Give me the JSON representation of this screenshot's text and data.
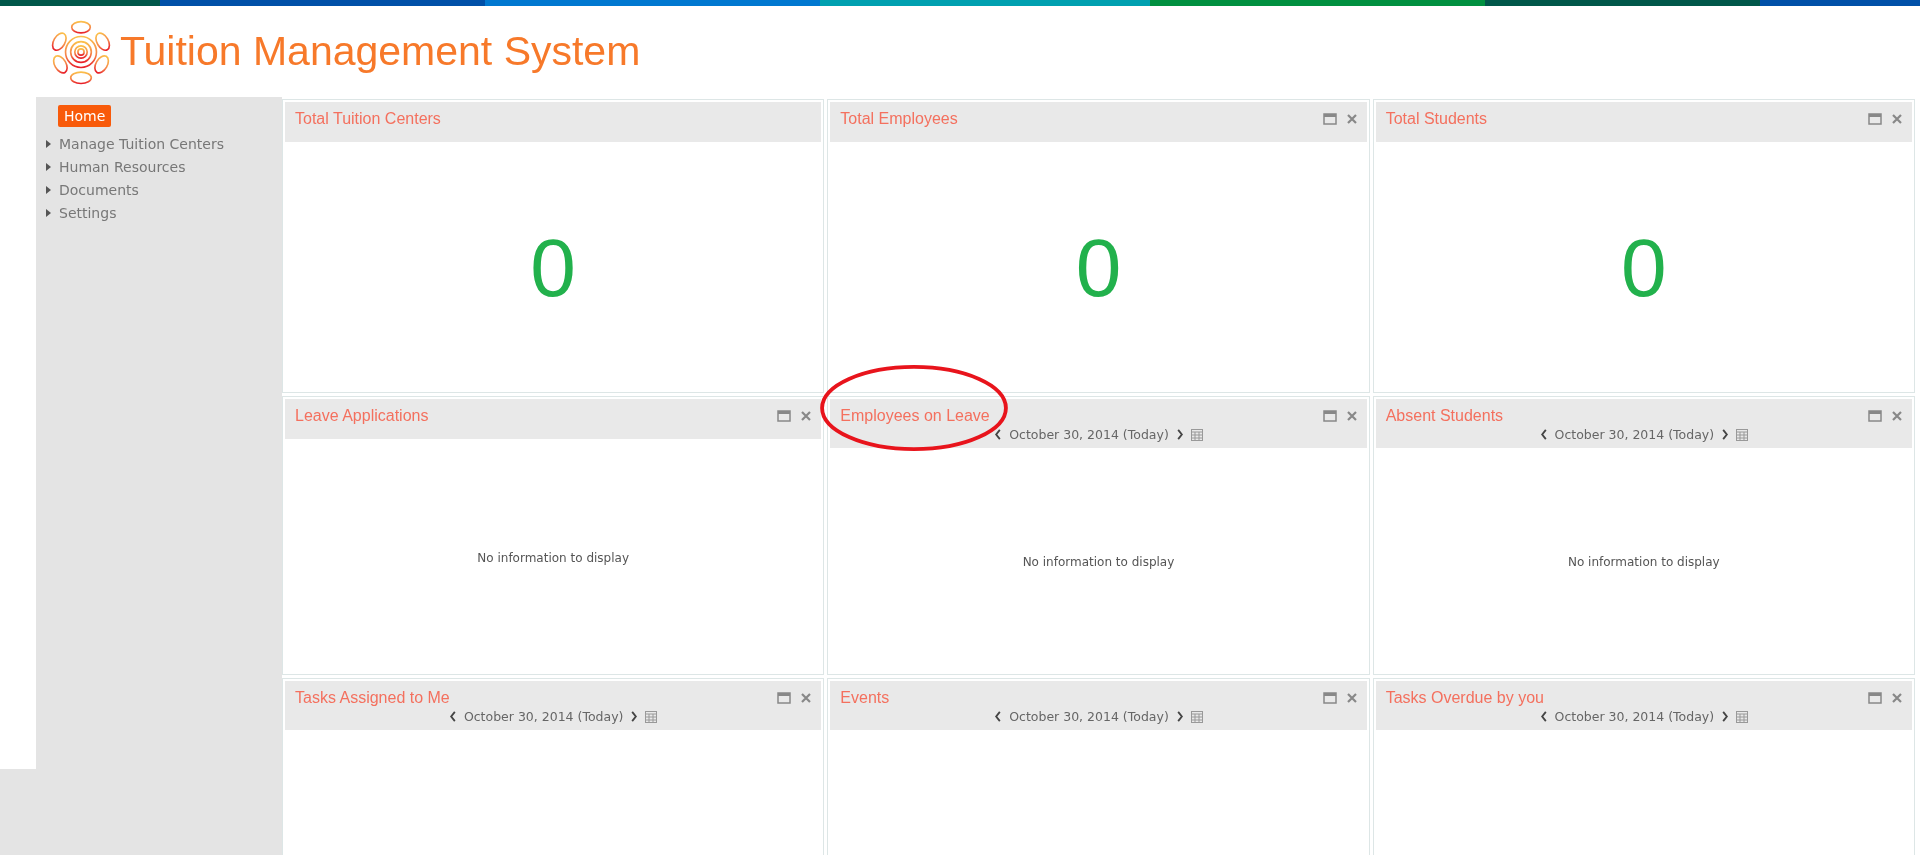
{
  "header": {
    "title": "Tuition Management System"
  },
  "sidebar": {
    "items": [
      {
        "label": "Home",
        "selected": true,
        "kind": "link"
      },
      {
        "label": "Manage Tuition Centers",
        "selected": false,
        "kind": "group"
      },
      {
        "label": "Human Resources",
        "selected": false,
        "kind": "group"
      },
      {
        "label": "Documents",
        "selected": false,
        "kind": "group"
      },
      {
        "label": "Settings",
        "selected": false,
        "kind": "group"
      }
    ]
  },
  "widgets": [
    {
      "title": "Total Tuition Centers",
      "kind": "count",
      "value": "0",
      "controls": false,
      "highlighted": false
    },
    {
      "title": "Total Employees",
      "kind": "count",
      "value": "0",
      "controls": true,
      "highlighted": false
    },
    {
      "title": "Total Students",
      "kind": "count",
      "value": "0",
      "controls": true,
      "highlighted": false
    },
    {
      "title": "Leave Applications",
      "kind": "message",
      "message": "No information to display",
      "controls": true,
      "highlighted": false
    },
    {
      "title": "Employees on Leave",
      "kind": "message",
      "date": "October 30, 2014 (Today)",
      "message": "No information to display",
      "controls": true,
      "highlighted": true
    },
    {
      "title": "Absent Students",
      "kind": "message",
      "date": "October 30, 2014 (Today)",
      "message": "No information to display",
      "controls": true,
      "highlighted": false
    },
    {
      "title": "Tasks Assigned to Me",
      "kind": "empty",
      "date": "October 30, 2014 (Today)",
      "controls": true,
      "highlighted": false
    },
    {
      "title": "Events",
      "kind": "empty",
      "date": "October 30, 2014 (Today)",
      "controls": true,
      "highlighted": false
    },
    {
      "title": "Tasks Overdue by you",
      "kind": "empty",
      "date": "October 30, 2014 (Today)",
      "controls": true,
      "highlighted": false
    }
  ]
}
